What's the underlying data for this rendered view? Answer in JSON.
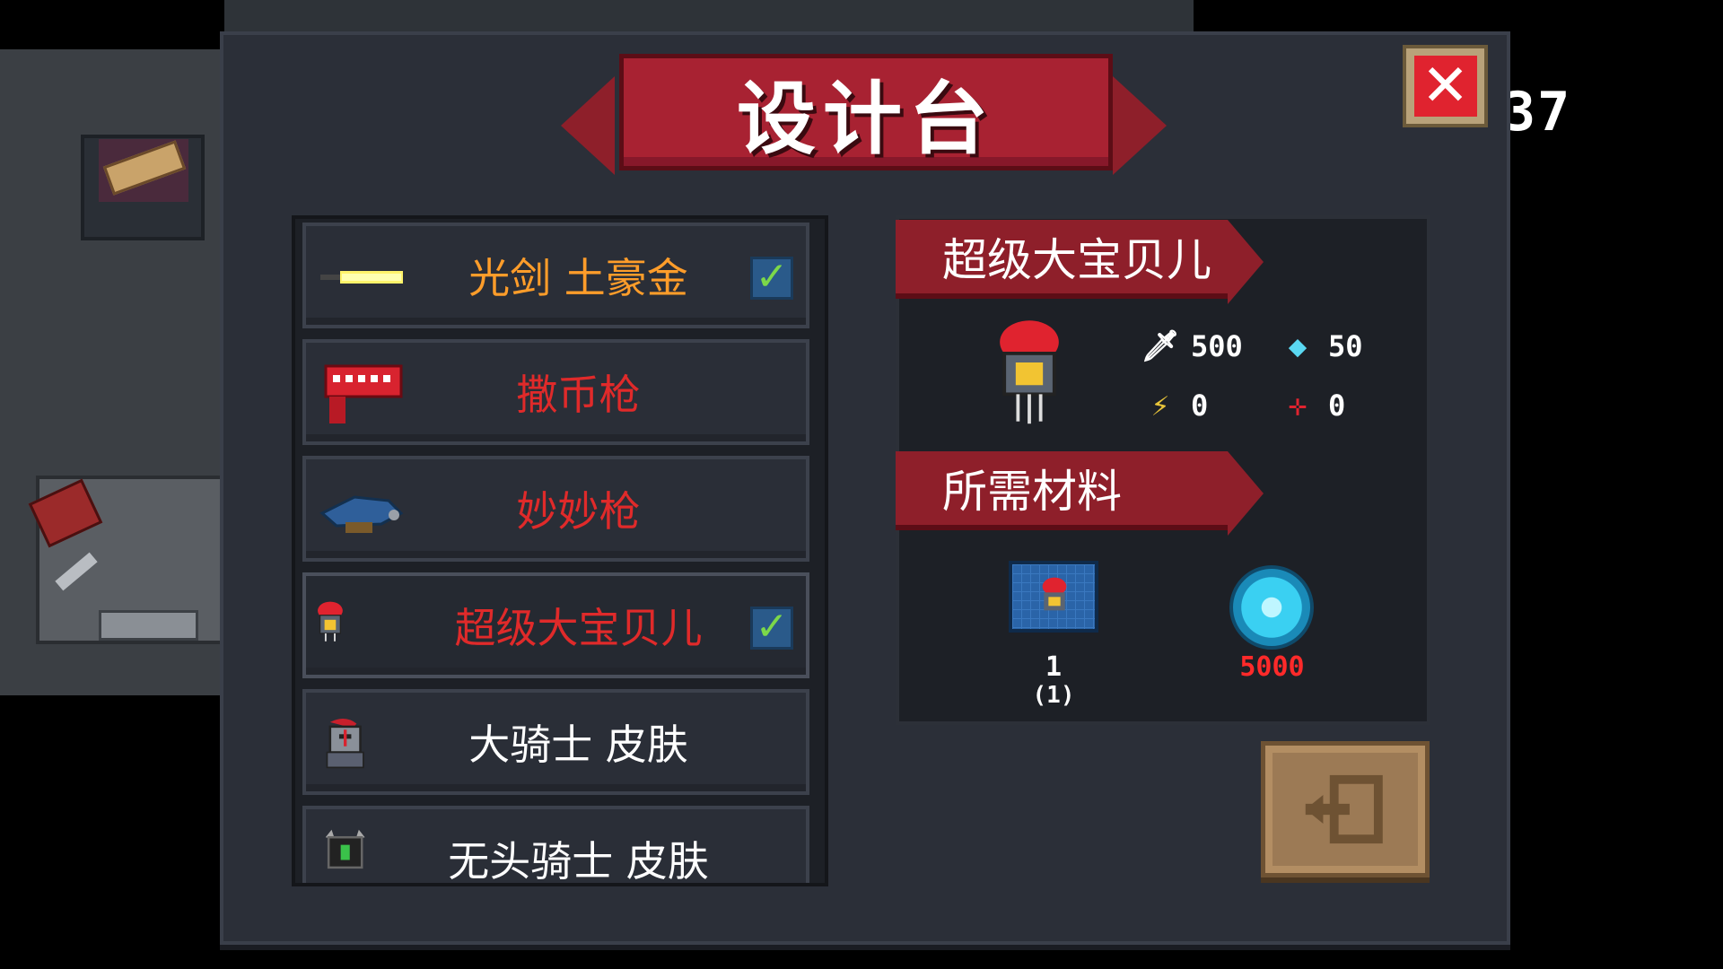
{
  "header": {
    "title": "设计台",
    "close_label": "✕"
  },
  "hud": {
    "counter_text": "37"
  },
  "recipes": [
    {
      "label": "光剑 土豪金",
      "color": "#ff9d2a",
      "checked": true,
      "icon": "lightsaber-icon"
    },
    {
      "label": "撒币枪",
      "color": "#e02a2a",
      "checked": false,
      "icon": "coin-gun-icon"
    },
    {
      "label": "妙妙枪",
      "color": "#e02a2a",
      "checked": false,
      "icon": "mystery-gun-icon"
    },
    {
      "label": "超级大宝贝儿",
      "color": "#e02a2a",
      "checked": true,
      "icon": "super-baby-pet-icon"
    },
    {
      "label": "大骑士 皮肤",
      "color": "#ffffff",
      "checked": false,
      "icon": "knight-skin-icon"
    },
    {
      "label": "无头骑士 皮肤",
      "color": "#ffffff",
      "checked": false,
      "icon": "headless-knight-icon"
    }
  ],
  "detail": {
    "name": "超级大宝贝儿",
    "stats": {
      "attack": "500",
      "energy": "50",
      "critical": "0",
      "spread": "0"
    },
    "materials_title": "所需材料",
    "materials": {
      "blueprint_count": "1",
      "blueprint_owned": "(1)",
      "gem_count": "5000"
    }
  },
  "actions": {
    "exit_icon": "exit-icon"
  },
  "colors": {
    "accent_red": "#a82232",
    "panel_bg": "#2b2f38",
    "gem_cost": "#ff2a2a"
  }
}
